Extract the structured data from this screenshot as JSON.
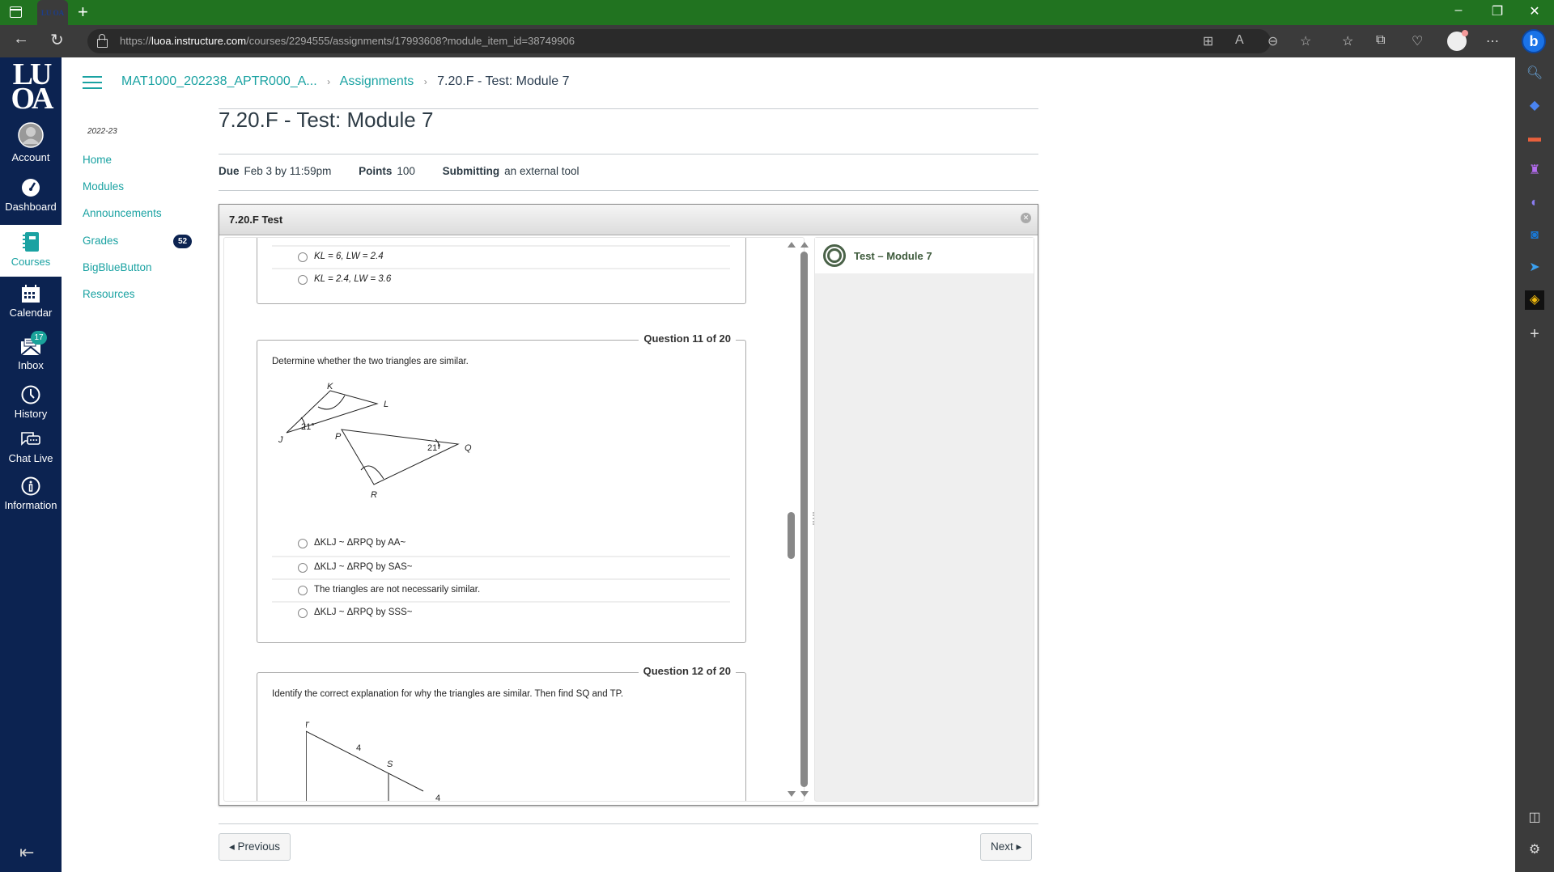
{
  "browser": {
    "url_prefix": "https://",
    "url_domain": "luoa.instructure.com",
    "url_path": "/courses/2294555/assignments/17993608?module_item_id=38749906",
    "tab_favicon": "LU OA",
    "new_tab": "+",
    "controls": {
      "minimize": "–",
      "restore": "❐",
      "close": "✕"
    }
  },
  "global_nav": {
    "logo": "LU OA",
    "items": [
      {
        "label": "Account",
        "icon": "avatar-icon"
      },
      {
        "label": "Dashboard",
        "icon": "dashboard-icon"
      },
      {
        "label": "Courses",
        "icon": "courses-icon",
        "active": true
      },
      {
        "label": "Calendar",
        "icon": "calendar-icon"
      },
      {
        "label": "Inbox",
        "icon": "inbox-icon",
        "badge": "17"
      },
      {
        "label": "History",
        "icon": "clock-icon"
      },
      {
        "label": "Chat Live",
        "icon": "chat-icon"
      },
      {
        "label": "Information",
        "icon": "info-icon"
      }
    ]
  },
  "breadcrumb": {
    "course": "MAT1000_202238_APTR000_A...",
    "section": "Assignments",
    "current": "7.20.F - Test: Module 7"
  },
  "course_nav": {
    "term": "2022-23",
    "items": [
      {
        "label": "Home"
      },
      {
        "label": "Modules"
      },
      {
        "label": "Announcements"
      },
      {
        "label": "Grades",
        "badge": "52"
      },
      {
        "label": "BigBlueButton"
      },
      {
        "label": "Resources"
      }
    ]
  },
  "assignment": {
    "title": "7.20.F - Test: Module 7",
    "due_label": "Due",
    "due_value": "Feb 3 by 11:59pm",
    "points_label": "Points",
    "points_value": "100",
    "submitting_label": "Submitting",
    "submitting_value": "an external tool"
  },
  "tool": {
    "title": "7.20.F Test",
    "side_title": "Test – Module 7",
    "prev_question_options": [
      {
        "text": "KL = 6, LW = 2.4"
      },
      {
        "text": "KL = 2.4, LW = 3.6"
      }
    ],
    "questions": [
      {
        "label": "Question 11 of 20",
        "prompt": "Determine whether the two triangles are similar.",
        "figure": {
          "vertices": [
            "K",
            "L",
            "J",
            "P",
            "Q",
            "R"
          ],
          "angle_labels": [
            "21°",
            "21°"
          ]
        },
        "options": [
          {
            "text": "ΔKLJ ~ ΔRPQ by AA~"
          },
          {
            "text": "ΔKLJ ~ ΔRPQ by SAS~"
          },
          {
            "text": "The triangles are not necessarily similar."
          },
          {
            "text": "ΔKLJ ~ ΔRPQ by SSS~"
          }
        ]
      },
      {
        "label": "Question 12 of 20",
        "prompt": "Identify the correct explanation for why the triangles are similar. Then find SQ and TP.",
        "figure": {
          "vertices": [
            "T",
            "S"
          ],
          "side_labels": [
            "4",
            "4"
          ]
        }
      }
    ]
  },
  "footer": {
    "previous": "◂ Previous",
    "next": "Next ▸"
  }
}
